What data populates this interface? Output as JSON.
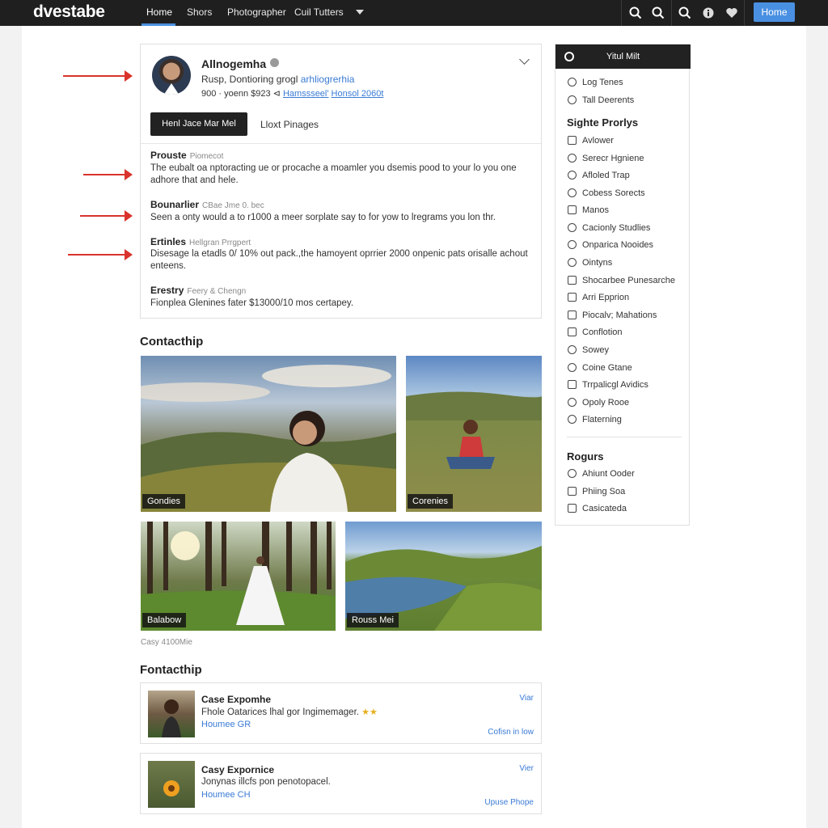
{
  "topbar": {
    "logo": "dvestabe",
    "nav": [
      "Home",
      "Shors",
      "Photographer",
      "Cuil Tutters"
    ],
    "home_button": "Home",
    "icons": [
      "search-icon",
      "search-icon",
      "search-icon",
      "info-icon",
      "heart-icon"
    ]
  },
  "profile": {
    "name": "Allnogemha",
    "subtitle_prefix": "Rusp, Dontioring grogl ",
    "subtitle_link": "arhliogrerhia",
    "meta_prefix": "900 · yoenn $923 ⊲ ",
    "meta_link1": "Hamssseel'",
    "meta_link2": "Honsol 2060t",
    "primary_button": "Henl Jace Mar Mel",
    "secondary_button": "Lloxt Pinages",
    "sections": [
      {
        "title": "Prouste",
        "tag": "Piomecot",
        "text": "The eubalt oa nptoracting ue or procache a moamler you dsemis pood to your lo you one adhore that and hele."
      },
      {
        "title": "Bounarlier",
        "tag": "CBae Jme 0. bec",
        "text": "Seen a onty would a to r1000 a meer sorplate say to for yow to lregrams you lon thr."
      },
      {
        "title": "Ertinles",
        "tag": "Hellgran Prrgpert",
        "text": "Disesage la etadls 0/ 10% out pack.,the hamoyent oprrier 2000 onpenic pats orisalle achout enteens."
      },
      {
        "title": "Erestry",
        "tag": "Feery & Chengn",
        "text": "Fionplea Glenines fater $13000/10 mos certapey."
      }
    ]
  },
  "gallery": {
    "heading": "Contacthip",
    "captions": [
      "Gondies",
      "Corenies",
      "Balabow",
      "Rouss Mei"
    ],
    "credit": "Casy 4100Mie"
  },
  "list": {
    "heading": "Fontacthip",
    "items": [
      {
        "title": "Case Expomhe",
        "text": "Fhole Oatarices lhal gor Ingimemager.",
        "stars": "★★",
        "link": "Houmee GR",
        "view": "Viar",
        "action": "Cofisn in low"
      },
      {
        "title": "Casy Expornice",
        "text": "Jonynas illcfs pon penotopacel.",
        "stars": "",
        "link": "Houmee CH",
        "view": "Vier",
        "action": "Upuse Phope"
      }
    ]
  },
  "sidebar": {
    "header": "Yitul Milt",
    "top_items": [
      "Log Tenes",
      "Tall Deerents"
    ],
    "section1_title": "Sighte  Prorlys",
    "section1_items": [
      "Avlower",
      "Serecr Hgniene",
      "Afloled Trap",
      "Cobess Sorects",
      "Manos",
      "Cacionly Studlies",
      "Onparica Nooides",
      "Ointyns",
      "Shocarbee Punesarche",
      "Arri Epprion",
      "Piocalv; Mahations",
      "Conflotion",
      "Sowey",
      "Coine Gtane",
      "Trrpalicgl Avidics",
      "Opoly Rooe",
      "Flaterning"
    ],
    "section2_title": "Rogurs",
    "section2_items": [
      "Ahiunt Ooder",
      "Phiing Soa",
      "Casicateda"
    ]
  }
}
